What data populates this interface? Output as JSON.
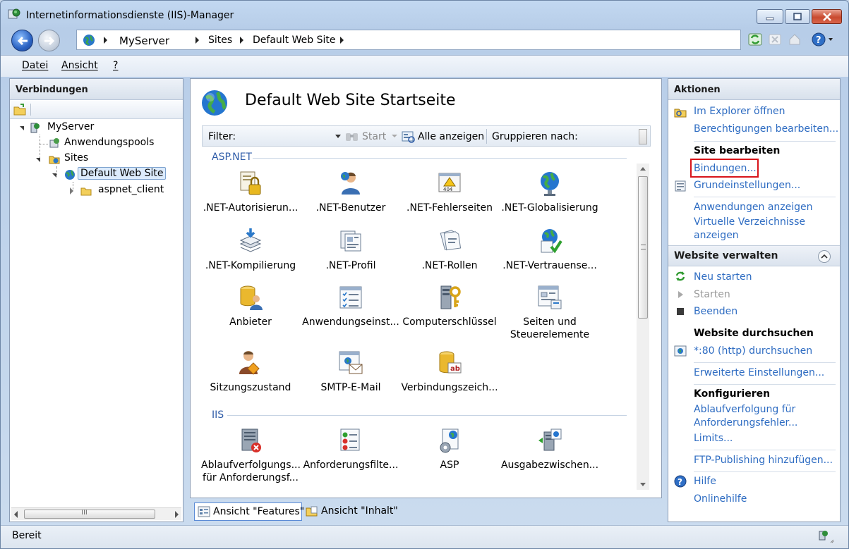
{
  "window": {
    "title": "Internetinformationsdienste (IIS)-Manager",
    "minimize_glyph": "–",
    "maximize_glyph": "□",
    "close_glyph": "✕"
  },
  "address": {
    "crumbs": [
      "MyServer",
      "Sites",
      "Default Web Site"
    ]
  },
  "menu": {
    "items": [
      "Datei",
      "Ansicht",
      "?"
    ]
  },
  "connections": {
    "header": "Verbindungen",
    "tree": {
      "server": "MyServer",
      "app_pools": "Anwendungspools",
      "sites": "Sites",
      "default_site": "Default Web Site",
      "aspnet_client": "aspnet_client"
    },
    "hscroll_grip": "III"
  },
  "center": {
    "title": "Default Web Site Startseite",
    "filter": {
      "label": "Filter:",
      "start": "Start",
      "show_all": "Alle anzeigen",
      "group_by": "Gruppieren nach:"
    },
    "groups": {
      "aspnet": "ASP.NET",
      "iis": "IIS"
    },
    "features_aspnet": [
      {
        "label": ".NET-Autorisierun...",
        "icon": "lock-doc-icon"
      },
      {
        "label": ".NET-Benutzer",
        "icon": "user-icon"
      },
      {
        "label": ".NET-Fehlerseiten",
        "icon": "error-404-icon"
      },
      {
        "label": ".NET-Globalisierung",
        "icon": "globe-icon"
      },
      {
        "label": ".NET-Kompilierung",
        "icon": "compile-stack-icon"
      },
      {
        "label": ".NET-Profil",
        "icon": "profile-icon"
      },
      {
        "label": ".NET-Rollen",
        "icon": "roles-icon"
      },
      {
        "label": ".NET-Vertrauense...",
        "icon": "trust-check-icon"
      },
      {
        "label": "Anbieter",
        "icon": "provider-db-icon"
      },
      {
        "label": "Anwendungseinst...",
        "icon": "app-settings-icon"
      },
      {
        "label": "Computerschlüssel",
        "icon": "machine-key-icon"
      },
      {
        "label": "Seiten und\nSteuerelemente",
        "icon": "pages-controls-icon"
      },
      {
        "label": "Sitzungszustand",
        "icon": "session-state-icon"
      },
      {
        "label": "SMTP-E-Mail",
        "icon": "smtp-mail-icon"
      },
      {
        "label": "Verbindungszeich...",
        "icon": "connection-string-icon"
      }
    ],
    "features_iis": [
      {
        "label": "Ablaufverfolgungs...\nfür Anforderungsf...",
        "icon": "failed-request-trace-icon"
      },
      {
        "label": "Anforderungsfilte...",
        "icon": "request-filter-icon"
      },
      {
        "label": "ASP",
        "icon": "asp-icon"
      },
      {
        "label": "Ausgabezwischen...",
        "icon": "output-cache-icon"
      }
    ]
  },
  "viewtabs": {
    "features": "Ansicht \"Features\"",
    "content": "Ansicht \"Inhalt\""
  },
  "actions": {
    "header": "Aktionen",
    "explore": "Im Explorer öffnen",
    "permissions": "Berechtigungen bearbeiten...",
    "edit_site": "Site bearbeiten",
    "bindings": "Bindungen...",
    "basic_settings": "Grundeinstellungen...",
    "view_apps": "Anwendungen anzeigen",
    "view_vdirs_1": "Virtuelle Verzeichnisse",
    "view_vdirs_2": "anzeigen",
    "manage_site": "Website verwalten",
    "restart": "Neu starten",
    "start": "Starten",
    "stop": "Beenden",
    "browse_site": "Website durchsuchen",
    "browse_80": "*:80 (http) durchsuchen",
    "advanced": "Erweiterte Einstellungen...",
    "configure": "Konfigurieren",
    "frt_1": "Ablaufverfolgung für",
    "frt_2": "Anforderungsfehler...",
    "limits": "Limits...",
    "ftp": "FTP-Publishing hinzufügen...",
    "help": "Hilfe",
    "online_help": "Onlinehilfe"
  },
  "status": {
    "text": "Bereit"
  },
  "colors": {
    "link": "#2e6cc2",
    "group_header": "#2f5ca8",
    "highlight": "#d8141a"
  }
}
